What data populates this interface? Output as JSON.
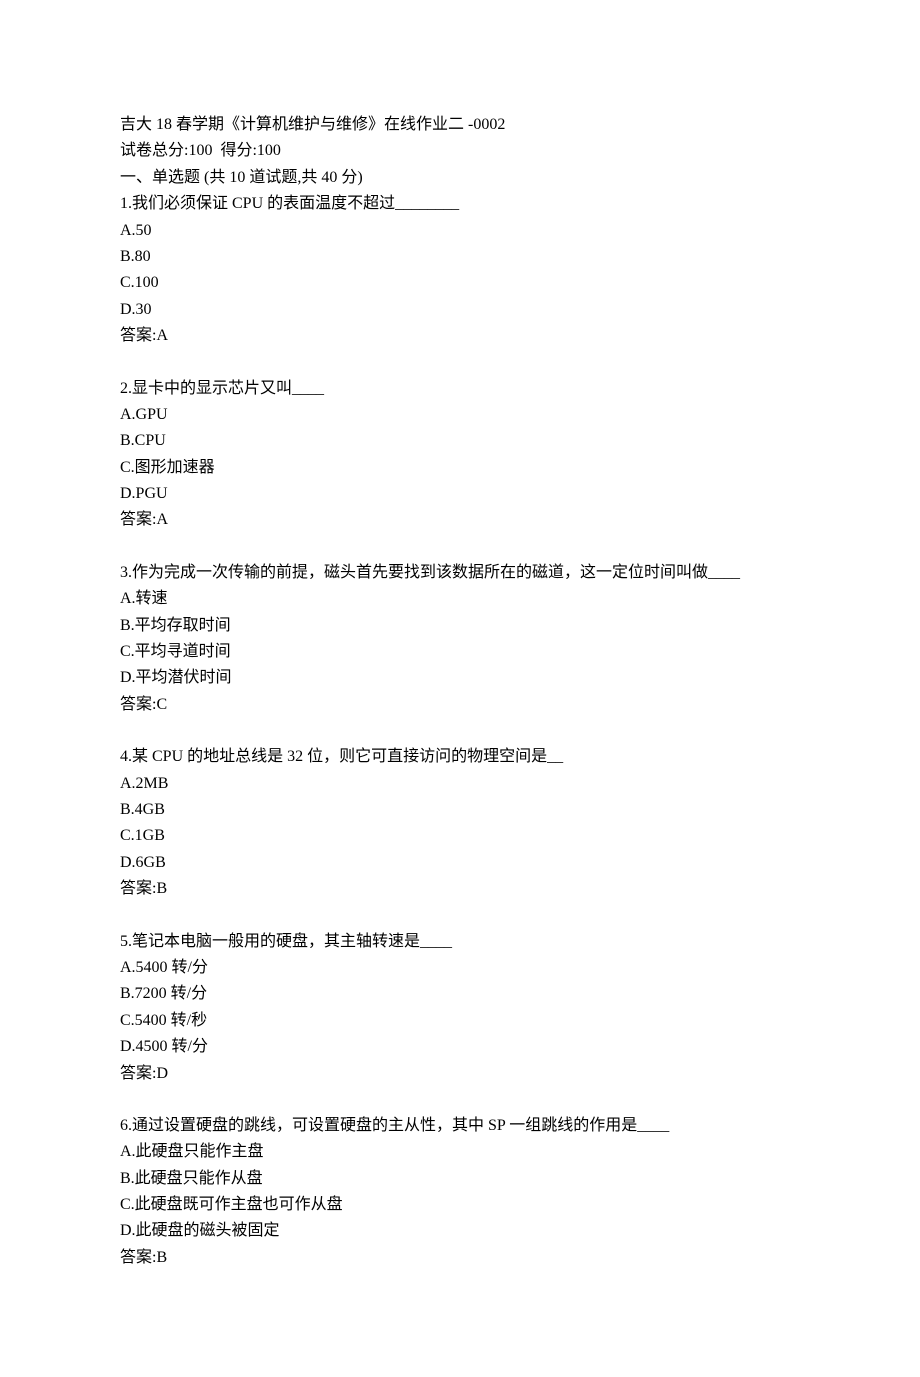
{
  "header": {
    "title": "吉大 18 春学期《计算机维护与维修》在线作业二 -0002",
    "score_line": "试卷总分:100  得分:100",
    "section_title": "一、单选题 (共 10 道试题,共 40 分)"
  },
  "questions": [
    {
      "stem": "1.我们必须保证 CPU 的表面温度不超过________",
      "options": [
        "A.50",
        "B.80",
        "C.100",
        "D.30"
      ],
      "answer": "答案:A"
    },
    {
      "stem": "2.显卡中的显示芯片又叫____",
      "options": [
        "A.GPU",
        "B.CPU",
        "C.图形加速器",
        "D.PGU"
      ],
      "answer": "答案:A"
    },
    {
      "stem": "3.作为完成一次传输的前提，磁头首先要找到该数据所在的磁道，这一定位时间叫做____",
      "options": [
        "A.转速",
        "B.平均存取时间",
        "C.平均寻道时间",
        "D.平均潜伏时间"
      ],
      "answer": "答案:C"
    },
    {
      "stem": "4.某 CPU 的地址总线是 32 位，则它可直接访问的物理空间是__",
      "options": [
        "A.2MB",
        "B.4GB",
        "C.1GB",
        "D.6GB"
      ],
      "answer": "答案:B"
    },
    {
      "stem": "5.笔记本电脑一般用的硬盘，其主轴转速是____",
      "options": [
        "A.5400 转/分",
        "B.7200 转/分",
        "C.5400 转/秒",
        "D.4500 转/分"
      ],
      "answer": "答案:D"
    },
    {
      "stem": "6.通过设置硬盘的跳线，可设置硬盘的主从性，其中 SP 一组跳线的作用是____",
      "options": [
        "A.此硬盘只能作主盘",
        "B.此硬盘只能作从盘",
        "C.此硬盘既可作主盘也可作从盘",
        "D.此硬盘的磁头被固定"
      ],
      "answer": "答案:B"
    }
  ]
}
